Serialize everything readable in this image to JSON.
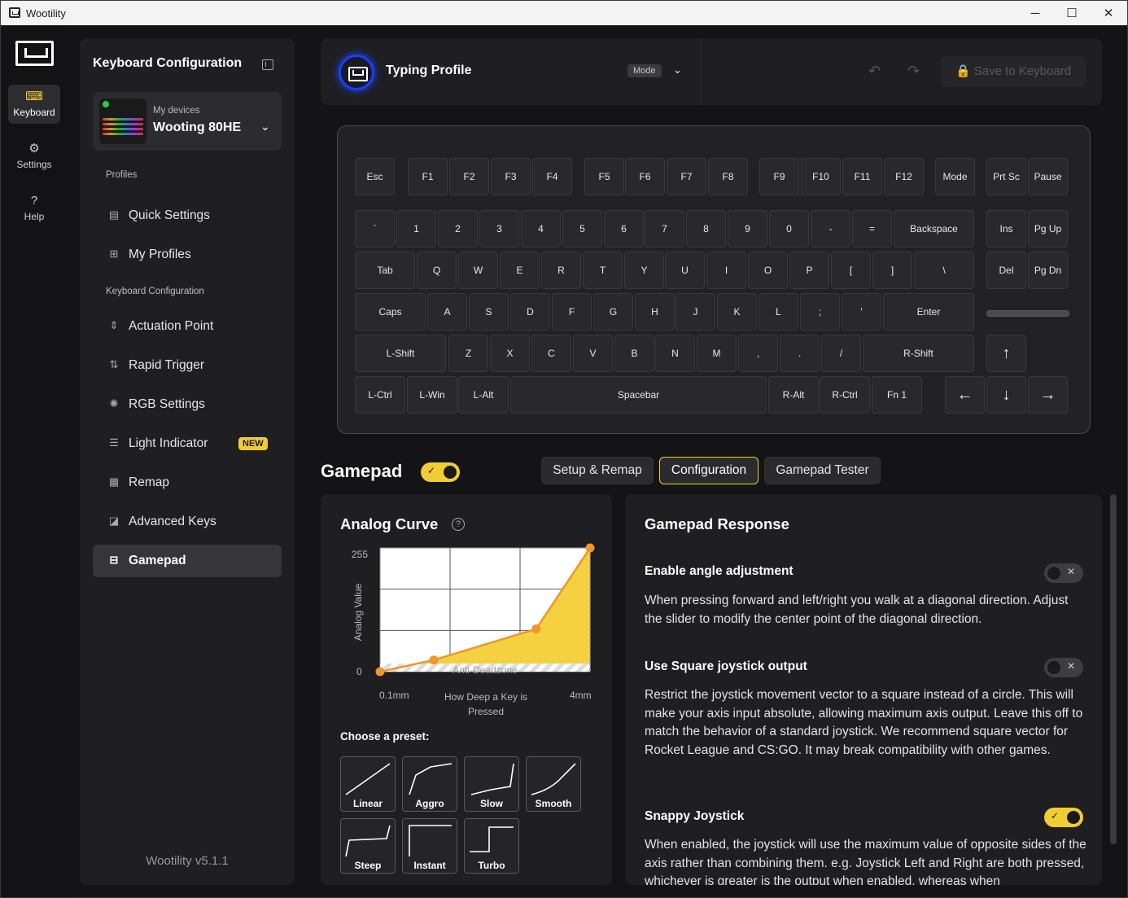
{
  "window": {
    "title": "Wootility",
    "minimize": "─",
    "maximize": "☐",
    "close": "✕"
  },
  "rail": {
    "items": [
      {
        "label": "Keyboard",
        "icon": "keyboard-icon",
        "glyph": "⌨"
      },
      {
        "label": "Settings",
        "icon": "gear-icon",
        "glyph": "⚙"
      },
      {
        "label": "Help",
        "icon": "help-icon",
        "glyph": "?"
      }
    ]
  },
  "sidebar": {
    "title": "Keyboard Configuration",
    "device": {
      "label": "My devices",
      "name": "Wooting 80HE",
      "chevron": "⌄"
    },
    "profiles_heading": "Profiles",
    "profile_items": [
      {
        "label": "Quick Settings",
        "icon": "quick-settings-icon",
        "glyph": "▤"
      },
      {
        "label": "My Profiles",
        "icon": "profiles-grid-icon",
        "glyph": "⊞"
      }
    ],
    "config_heading": "Keyboard Configuration",
    "config_items": [
      {
        "label": "Actuation Point",
        "icon": "actuation-point-icon",
        "glyph": "⇕"
      },
      {
        "label": "Rapid Trigger",
        "icon": "rapid-trigger-icon",
        "glyph": "⇅"
      },
      {
        "label": "RGB Settings",
        "icon": "rgb-sun-icon",
        "glyph": "✺"
      },
      {
        "label": "Light Indicator",
        "icon": "light-indicator-icon",
        "glyph": "☰",
        "badge": "NEW"
      },
      {
        "label": "Remap",
        "icon": "remap-icon",
        "glyph": "▦"
      },
      {
        "label": "Advanced Keys",
        "icon": "advanced-keys-icon",
        "glyph": "◪"
      },
      {
        "label": "Gamepad",
        "icon": "gamepad-icon",
        "glyph": "⊟",
        "active": true
      }
    ],
    "version": "Wootility v5.1.1"
  },
  "topbar": {
    "profile_name": "Typing Profile",
    "mode_label": "Mode",
    "mode_chevron": "⌄",
    "undo": "↶",
    "redo": "↷",
    "save_label": "🔒 Save to Keyboard"
  },
  "keyboard": {
    "rows": [
      [
        "Esc",
        "F1",
        "F2",
        "F3",
        "F4",
        "F5",
        "F6",
        "F7",
        "F8",
        "F9",
        "F10",
        "F11",
        "F12",
        "Mode",
        "Prt Sc",
        "Pause"
      ],
      [
        "`",
        "1",
        "2",
        "3",
        "4",
        "5",
        "6",
        "7",
        "8",
        "9",
        "0",
        "-",
        "=",
        "Backspace",
        "Ins",
        "Pg Up"
      ],
      [
        "Tab",
        "Q",
        "W",
        "E",
        "R",
        "T",
        "Y",
        "U",
        "I",
        "O",
        "P",
        "[",
        "]",
        "\\",
        "Del",
        "Pg Dn"
      ],
      [
        "Caps",
        "A",
        "S",
        "D",
        "F",
        "G",
        "H",
        "J",
        "K",
        "L",
        ";",
        "'",
        "Enter"
      ],
      [
        "L-Shift",
        "Z",
        "X",
        "C",
        "V",
        "B",
        "N",
        "M",
        ",",
        ".",
        "/",
        "R-Shift",
        "↑"
      ],
      [
        "L-Ctrl",
        "L-Win",
        "L-Alt",
        "Spacebar",
        "R-Alt",
        "R-Ctrl",
        "Fn 1",
        "←",
        "↓",
        "→"
      ]
    ]
  },
  "gamepad": {
    "title": "Gamepad",
    "enabled": true,
    "toggle_mark": "✓",
    "tabs": [
      {
        "label": "Setup & Remap",
        "active": false
      },
      {
        "label": "Configuration",
        "active": true
      },
      {
        "label": "Gamepad Tester",
        "active": false
      }
    ]
  },
  "analog_curve": {
    "title": "Analog Curve",
    "help": "?",
    "y_top": "255",
    "y_bottom": "0",
    "y_axis_label": "Analog Value",
    "x_left": "0.1mm",
    "x_mid": "How Deep a Key is Pressed",
    "x_right": "4mm",
    "deadzone_label": "Anti-Deadzone",
    "preset_heading": "Choose a preset:",
    "presets": [
      "Linear",
      "Aggro",
      "Slow",
      "Smooth",
      "Steep",
      "Instant",
      "Turbo"
    ]
  },
  "chart_data": {
    "type": "area",
    "x": [
      0.1,
      1.1,
      3.0,
      4.0
    ],
    "y": [
      0,
      24,
      88,
      255
    ],
    "xlim": [
      0.1,
      4.0
    ],
    "ylim": [
      0,
      255
    ],
    "xlabel": "How Deep a Key is Pressed",
    "ylabel": "Analog Value"
  },
  "gamepad_response": {
    "title": "Gamepad Response",
    "options": [
      {
        "title": "Enable angle adjustment",
        "enabled": false,
        "toggle_mark": "✕",
        "description": "When pressing forward and left/right you walk at a diagonal direction. Adjust the slider to modify the center point of the diagonal direction."
      },
      {
        "title": "Use Square joystick output",
        "enabled": false,
        "toggle_mark": "✕",
        "description": "Restrict the joystick movement vector to a square instead of a circle. This will make your axis input absolute, allowing maximum axis output. Leave this off to match the behavior of a standard joystick. We recommend square vector for Rocket League and CS:GO. It may break compatibility with other games."
      },
      {
        "title": "Snappy Joystick",
        "enabled": true,
        "toggle_mark": "✓",
        "description": "When enabled, the joystick will use the maximum value of opposite sides of the axis rather than combining them. e.g. Joystick Left and Right are both pressed, whichever is greater is the output when enabled, whereas when"
      }
    ]
  },
  "colors": {
    "accent": "#f2cc35",
    "profile_ring": "#1a3dff",
    "background": "#141416",
    "panel": "#1f1f22"
  }
}
